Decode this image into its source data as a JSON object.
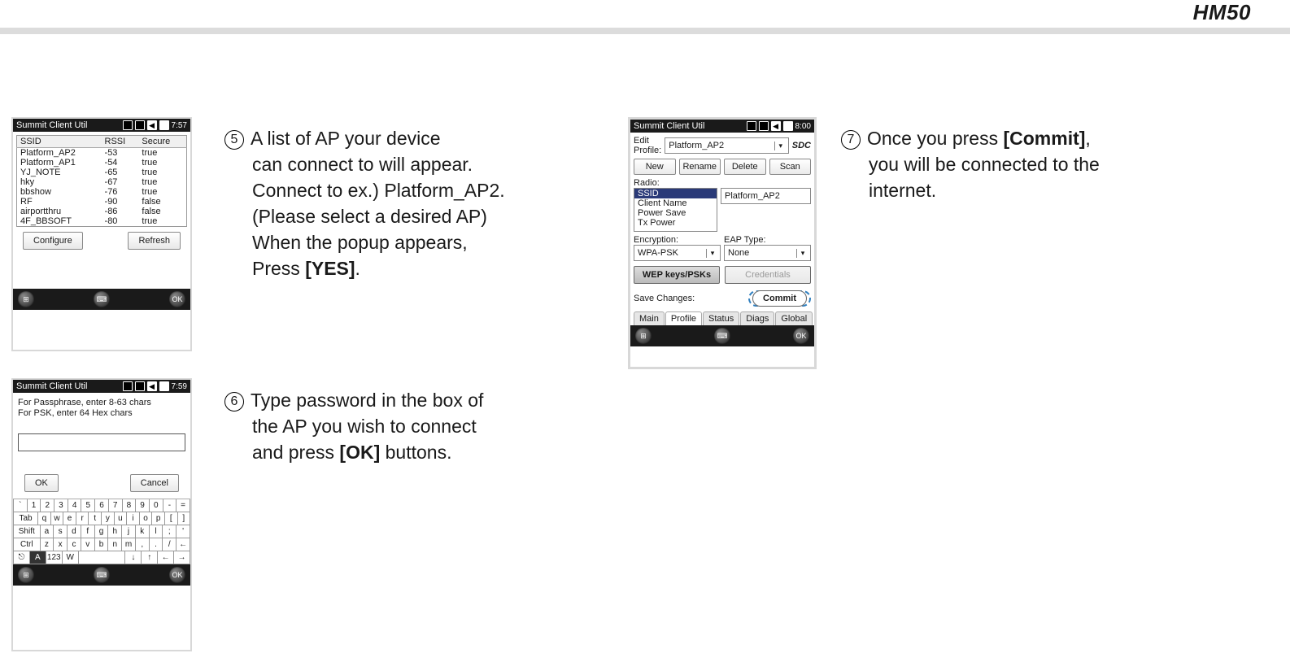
{
  "header": {
    "label": "HM50"
  },
  "phone1": {
    "title": "Summit Client Util",
    "time": "7:57",
    "columns": {
      "ssid": "SSID",
      "rssi": "RSSI",
      "secure": "Secure"
    },
    "rows": [
      {
        "ssid": "Platform_AP2",
        "rssi": "-53",
        "secure": "true"
      },
      {
        "ssid": "Platform_AP1",
        "rssi": "-54",
        "secure": "true"
      },
      {
        "ssid": "YJ_NOTE",
        "rssi": "-65",
        "secure": "true"
      },
      {
        "ssid": "hky",
        "rssi": "-67",
        "secure": "true"
      },
      {
        "ssid": "bbshow",
        "rssi": "-76",
        "secure": "true"
      },
      {
        "ssid": "RF",
        "rssi": "-90",
        "secure": "false"
      },
      {
        "ssid": "airportthru",
        "rssi": "-86",
        "secure": "false"
      },
      {
        "ssid": "4F_BBSOFT",
        "rssi": "-80",
        "secure": "true"
      }
    ],
    "configure": "Configure",
    "refresh": "Refresh"
  },
  "phone2": {
    "title": "Summit Client Util",
    "time": "7:59",
    "msg1": "For Passphrase, enter 8-63 chars",
    "msg2": "For PSK, enter 64 Hex chars",
    "ok": "OK",
    "cancel": "Cancel",
    "kb": {
      "row1": [
        "`",
        "1",
        "2",
        "3",
        "4",
        "5",
        "6",
        "7",
        "8",
        "9",
        "0",
        "-",
        "="
      ],
      "row2_lead": "Tab",
      "row2": [
        "q",
        "w",
        "e",
        "r",
        "t",
        "y",
        "u",
        "i",
        "o",
        "p",
        "[",
        "]"
      ],
      "row3_lead": "Shift",
      "row3": [
        "a",
        "s",
        "d",
        "f",
        "g",
        "h",
        "j",
        "k",
        "l",
        ";",
        "'"
      ],
      "row4_lead": "Ctrl",
      "row4": [
        "z",
        "x",
        "c",
        "v",
        "b",
        "n",
        "m",
        ",",
        ".",
        "/",
        "←"
      ],
      "mode_a": "A",
      "mode_num": "123",
      "mode_w": "W"
    }
  },
  "phone3": {
    "title": "Summit Client Util",
    "time": "8:00",
    "edit_profile_lbl": "Edit\nProfile:",
    "edit_profile_val": "Platform_AP2",
    "logo": "SDC",
    "btn_new": "New",
    "btn_rename": "Rename",
    "btn_delete": "Delete",
    "btn_scan": "Scan",
    "radio_lbl": "Radio:",
    "radio_opts": [
      "SSID",
      "Client Name",
      "Power Save",
      "Tx Power"
    ],
    "radio_val": "Platform_AP2",
    "encryption_lbl": "Encryption:",
    "encryption_val": "WPA-PSK",
    "eap_lbl": "EAP Type:",
    "eap_val": "None",
    "wep_btn": "WEP keys/PSKs",
    "credentials_btn": "Credentials",
    "save_lbl": "Save Changes:",
    "commit_btn": "Commit",
    "tabs": [
      "Main",
      "Profile",
      "Status",
      "Diags",
      "Global"
    ]
  },
  "steps": {
    "s5_num": "5",
    "s5_l1": "A list of AP your device",
    "s5_l2": "can connect to will appear.",
    "s5_l3": "Connect to ex.) Platform_AP2.",
    "s5_l4": "(Please select a desired AP)",
    "s5_l5": "When the popup appears,",
    "s5_l6a": "Press ",
    "s5_l6b": "[YES]",
    "s5_l6c": ".",
    "s6_num": "6",
    "s6_l1": "Type password in the box of",
    "s6_l2": "the AP you wish to connect",
    "s6_l3a": "and press ",
    "s6_l3b": "[OK]",
    "s6_l3c": " buttons.",
    "s7_num": "7",
    "s7_l1a": "Once you press ",
    "s7_l1b": "[Commit]",
    "s7_l1c": ",",
    "s7_l2": "you will be connected to the",
    "s7_l3": "internet."
  }
}
